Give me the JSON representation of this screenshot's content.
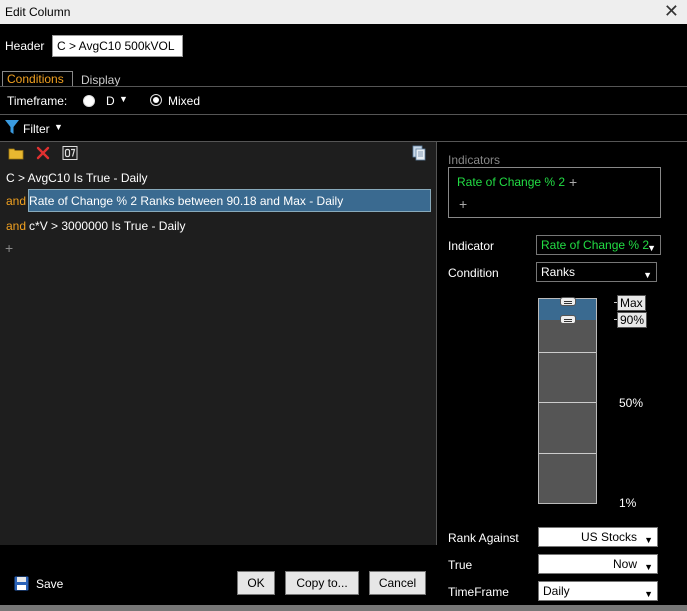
{
  "window": {
    "title": "Edit Column",
    "close_glyph": "✕"
  },
  "header": {
    "label": "Header",
    "value": "C > AvgC10 500kVOL"
  },
  "tabs": [
    {
      "label": "Conditions"
    },
    {
      "label": "Display"
    }
  ],
  "timeframe": {
    "label": "Timeframe:",
    "options": [
      "D",
      "Mixed"
    ],
    "selected": "Mixed"
  },
  "filter": {
    "label": "Filter"
  },
  "conditions": [
    {
      "prefix": "",
      "text": "C > AvgC10 Is True - Daily"
    },
    {
      "prefix": "and",
      "text": "Rate of Change % 2 Ranks between 90.18 and Max - Daily"
    },
    {
      "prefix": "and",
      "text": "c*V > 3000000 Is True - Daily"
    }
  ],
  "add_glyph": "+",
  "bottom": {
    "save_label": "Save",
    "ok_label": "OK",
    "copy_label": "Copy to...",
    "cancel_label": "Cancel"
  },
  "indicators": {
    "section_label": "Indicators",
    "items": [
      "Rate of Change % 2"
    ],
    "add_glyph": "+"
  },
  "indicator_field": {
    "label": "Indicator",
    "value": "Rate of Change % 2"
  },
  "condition_field": {
    "label": "Condition",
    "value": "Ranks"
  },
  "rank_slider": {
    "labels": {
      "max": "Max",
      "upper": "90%",
      "mid": "50%",
      "min": "1%"
    },
    "lower_value": 90.18,
    "upper_value": "Max"
  },
  "rank_against": {
    "label": "Rank Against",
    "value": "US Stocks"
  },
  "true_field": {
    "label": "True",
    "value": "Now"
  },
  "timeframe_field": {
    "label": "TimeFrame",
    "value": "Daily"
  },
  "colors": {
    "accent_orange": "#f0a020",
    "indicator_green": "#22dd44",
    "selection_blue": "#3a6a90"
  }
}
